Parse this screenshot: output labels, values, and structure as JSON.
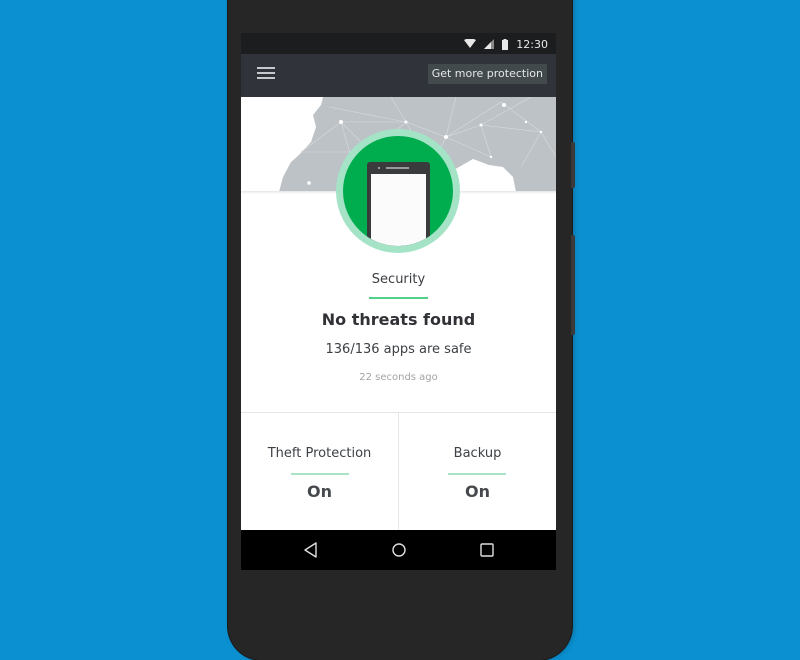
{
  "status_bar": {
    "time": "12:30",
    "icons": [
      "wifi-icon",
      "signal-icon",
      "battery-icon"
    ]
  },
  "toolbar": {
    "menu_icon": "hamburger-menu-icon",
    "get_more_protection_label": "Get more protection"
  },
  "hero": {
    "badge_icon": "phone-icon",
    "colors": {
      "badge_ring": "#a4e3c6",
      "badge_fill": "#00ad4e",
      "accent_line": "#4fd18a"
    }
  },
  "security": {
    "section_label": "Security",
    "title": "No threats found",
    "apps_safe": "136/136 apps are safe",
    "last_scan": "22 seconds ago"
  },
  "tiles": [
    {
      "label": "Theft Protection",
      "value": "On"
    },
    {
      "label": "Backup",
      "value": "On"
    }
  ],
  "nav_bar": {
    "buttons": [
      "back-icon",
      "home-icon",
      "recents-icon"
    ]
  }
}
